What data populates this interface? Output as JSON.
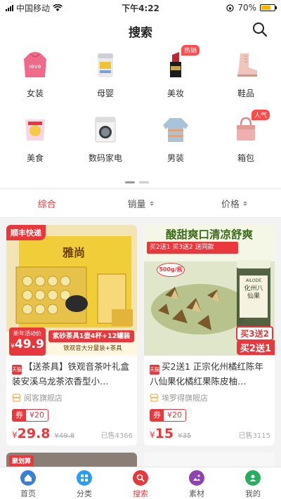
{
  "status_bar": {
    "carrier": "中国移动",
    "time": "下午4:22",
    "battery": "70%",
    "battery_level": 0.7
  },
  "header": {
    "title": "搜索",
    "search_icon": "search-icon"
  },
  "categories": [
    {
      "label": "女装",
      "icon": "hoodie-icon",
      "badge": ""
    },
    {
      "label": "母婴",
      "icon": "milk-powder-icon",
      "badge": ""
    },
    {
      "label": "美妆",
      "icon": "lipstick-icon",
      "badge": "热销"
    },
    {
      "label": "鞋品",
      "icon": "boot-icon",
      "badge": ""
    },
    {
      "label": "美食",
      "icon": "snack-icon",
      "badge": ""
    },
    {
      "label": "数码家电",
      "icon": "washing-machine-icon",
      "badge": ""
    },
    {
      "label": "男装",
      "icon": "sweater-icon",
      "badge": ""
    },
    {
      "label": "箱包",
      "icon": "handbag-icon",
      "badge": "人气"
    }
  ],
  "sort_bar": {
    "comprehensive": "综合",
    "sales": "销量",
    "price": "价格"
  },
  "products": [
    {
      "title": "【送茶具】铁观音茶叶礼盒装安溪乌龙茶浓香型小…",
      "shop": "阅客旗舰店",
      "platform_tag": "天猫",
      "coupon_label": "券",
      "coupon_value": "¥20",
      "currency": "¥",
      "price": "29.8",
      "original_price": "¥49.8",
      "sold": "已售4366",
      "image": {
        "corner_tag": "顺丰快递",
        "brand_text": "雅尚",
        "promo_line": "紫砂茶具1壶4杯+12罐装",
        "promo_sub": "铁观音大分量装+茶具",
        "deal_label": "新年活动价",
        "deal_price": "49.9",
        "deal_currency": "¥",
        "deal_suffix": "元"
      }
    },
    {
      "title": "买2送1 正宗化州橘红陈年八仙果化橘红果陈皮柚…",
      "shop": "埃罗得旗舰店",
      "platform_tag": "天猫",
      "coupon_label": "券",
      "coupon_value": "¥20",
      "currency": "¥",
      "price": "15",
      "original_price": "¥35",
      "sold": "已售3115",
      "image": {
        "headline": "酸甜爽口清凉舒爽",
        "promo_strip": "买2送1  买3送2  送同款",
        "weight_badge": "500g/瓶",
        "jar_label": "化州八仙果",
        "jar_brand": "AILODE",
        "offer_1": "买3送2",
        "offer_2": "买2送1"
      }
    }
  ],
  "peek_tag": "聚划算",
  "tab_bar": [
    {
      "label": "首页",
      "icon": "home-icon",
      "color": "#3a7fd5"
    },
    {
      "label": "分类",
      "icon": "category-icon",
      "color": "#2a9df4"
    },
    {
      "label": "搜索",
      "icon": "search-tab-icon",
      "color": "#e8383d"
    },
    {
      "label": "素材",
      "icon": "material-icon",
      "color": "#8e44ad"
    },
    {
      "label": "我的",
      "icon": "profile-icon",
      "color": "#27ae60"
    }
  ]
}
